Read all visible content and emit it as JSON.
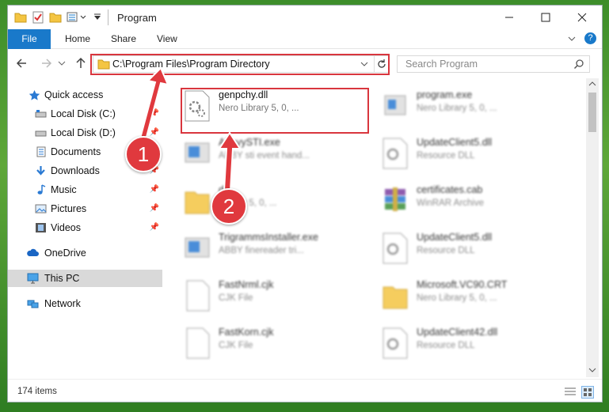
{
  "window": {
    "title": "Program"
  },
  "ribbon": {
    "tabs": [
      {
        "label": "File"
      },
      {
        "label": "Home"
      },
      {
        "label": "Share"
      },
      {
        "label": "View"
      }
    ]
  },
  "address": {
    "path": "C:\\Program Files\\Program Directory"
  },
  "search": {
    "placeholder": "Search Program"
  },
  "sidebar": {
    "items": [
      {
        "label": "Quick access"
      },
      {
        "label": "Local Disk (C:)"
      },
      {
        "label": "Local Disk (D:)"
      },
      {
        "label": "Documents"
      },
      {
        "label": "Downloads"
      },
      {
        "label": "Music"
      },
      {
        "label": "Pictures"
      },
      {
        "label": "Videos"
      },
      {
        "label": "OneDrive"
      },
      {
        "label": "This PC"
      },
      {
        "label": "Network"
      }
    ]
  },
  "files": [
    {
      "name": "genpchy.dll",
      "desc": "Nero Library 5, 0, ..."
    },
    {
      "name": "program.exe",
      "desc": "Nero Library 5, 0, ..."
    },
    {
      "name": "AbbyySTI.exe",
      "desc": "ABBY sti event hand..."
    },
    {
      "name": "UpdateClient5.dll",
      "desc": "Resource DLL"
    },
    {
      "name": "dll",
      "desc": "Library 5, 0, ..."
    },
    {
      "name": "certificates.cab",
      "desc": "WinRAR Archive"
    },
    {
      "name": "TrigrammsInstaller.exe",
      "desc": "ABBY finereader tri..."
    },
    {
      "name": "UpdateClient5.dll",
      "desc": "Resource DLL"
    },
    {
      "name": "FastNrml.cjk",
      "desc": "CJK File"
    },
    {
      "name": "Microsoft.VC90.CRT",
      "desc": "Nero Library 5, 0, ..."
    },
    {
      "name": "FastKorn.cjk",
      "desc": "CJK File"
    },
    {
      "name": "UpdateClient42.dll",
      "desc": "Resource DLL"
    }
  ],
  "status": {
    "count": "174 items"
  },
  "callouts": {
    "one": "1",
    "two": "2"
  },
  "colors": {
    "accent": "#1979ca",
    "highlight": "#d9363e",
    "callout": "#e0393e"
  }
}
